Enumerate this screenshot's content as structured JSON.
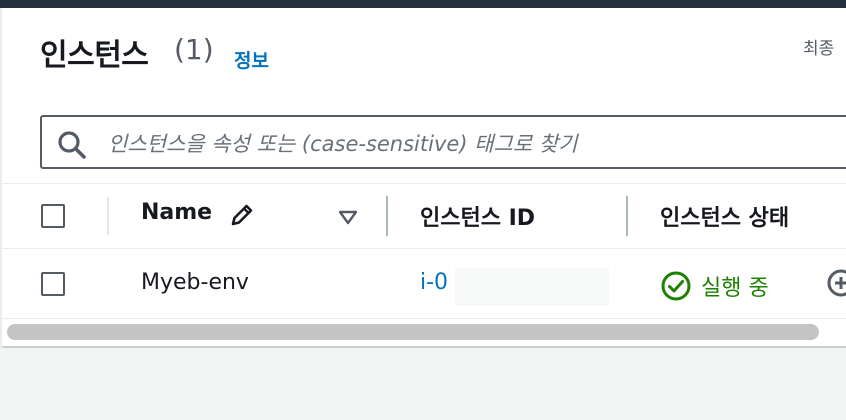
{
  "header": {
    "title": "인스턴스",
    "count": "(1)",
    "info_link": "정보",
    "last_updated_label": "최종"
  },
  "search": {
    "placeholder": "인스턴스을 속성 또는 (case-sensitive) 태그로 찾기"
  },
  "table": {
    "columns": [
      "Name",
      "인스턴스 ID",
      "인스턴스 상태"
    ],
    "rows": [
      {
        "name": "Myeb-env",
        "instance_id": "i-0",
        "state": "실행 중"
      }
    ]
  },
  "colors": {
    "link": "#0073bb",
    "running": "#1d8102",
    "text": "#16191f",
    "topbar": "#232f3e"
  },
  "icons": [
    "search-icon",
    "pencil-icon",
    "sort-down-icon",
    "check-circle-icon",
    "plus-circle-icon"
  ]
}
